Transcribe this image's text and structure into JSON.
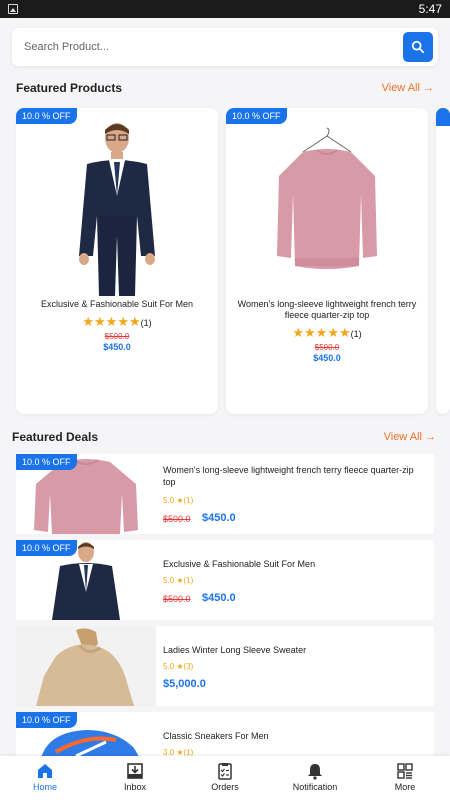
{
  "status_bar": {
    "time": "5:47"
  },
  "search": {
    "placeholder": "Search Product..."
  },
  "featured_products": {
    "title": "Featured Products",
    "view_all": "View All",
    "items": [
      {
        "badge": "10.0 % OFF",
        "name": "Exclusive & Fashionable Suit For Men",
        "stars": "★★★★★",
        "review_count": "(1)",
        "old_price": "$500.0",
        "new_price": "$450.0"
      },
      {
        "badge": "10.0 % OFF",
        "name": "Women's long-sleeve lightweight french terry fleece quarter-zip top",
        "stars": "★★★★★",
        "review_count": "(1)",
        "old_price": "$500.0",
        "new_price": "$450.0"
      }
    ]
  },
  "featured_deals": {
    "title": "Featured Deals",
    "view_all": "View All",
    "items": [
      {
        "badge": "10.0 % OFF",
        "name": "Women's long-sleeve lightweight french terry fleece quarter-zip top",
        "rating": "5.0",
        "review_count": "(1)",
        "old_price": "$500.0",
        "new_price": "$450.0"
      },
      {
        "badge": "10.0 % OFF",
        "name": "Exclusive & Fashionable Suit For Men",
        "rating": "5.0",
        "review_count": "(1)",
        "old_price": "$500.0",
        "new_price": "$450.0"
      },
      {
        "badge": "",
        "name": "Ladies Winter Long Sleeve Sweater",
        "rating": "5.0",
        "review_count": "(3)",
        "old_price": "",
        "new_price": "$5,000.0"
      },
      {
        "badge": "10.0 % OFF",
        "name": "Classic Sneakers For Men",
        "rating": "3.0",
        "review_count": "(1)",
        "old_price": "",
        "new_price": ""
      }
    ]
  },
  "bottom_nav": {
    "items": [
      {
        "label": "Home",
        "icon": "home-icon",
        "active": true
      },
      {
        "label": "Inbox",
        "icon": "inbox-icon",
        "active": false
      },
      {
        "label": "Orders",
        "icon": "orders-icon",
        "active": false
      },
      {
        "label": "Notification",
        "icon": "bell-icon",
        "active": false
      },
      {
        "label": "More",
        "icon": "grid-icon",
        "active": false
      }
    ]
  },
  "colors": {
    "accent": "#1a73e8",
    "view_all": "#e8732a",
    "old_price": "#e53935",
    "star": "#f2a619"
  }
}
